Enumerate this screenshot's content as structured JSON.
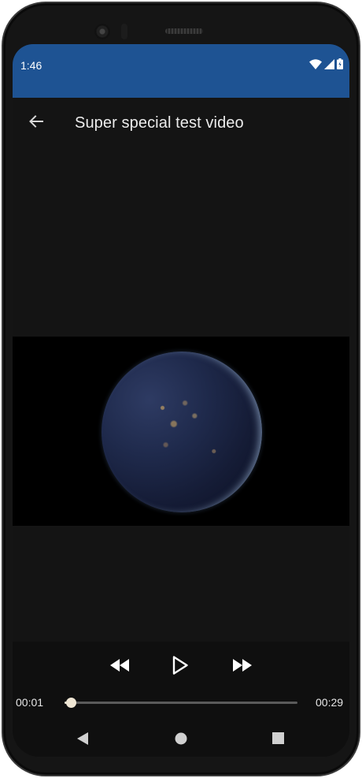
{
  "status_bar": {
    "time": "1:46",
    "icons": [
      "wifi-icon",
      "cell-signal-icon",
      "battery-icon"
    ],
    "color": "#1e5393"
  },
  "app_bar": {
    "back_icon": "arrow-left-icon",
    "title": "Super special test video"
  },
  "player": {
    "elapsed": "00:01",
    "duration": "00:29",
    "progress": 0.03,
    "controls": [
      "rewind-icon",
      "play-icon",
      "fast-forward-icon"
    ]
  },
  "nav_bar": {
    "buttons": [
      "back-triangle-icon",
      "home-circle-icon",
      "recents-square-icon"
    ]
  }
}
